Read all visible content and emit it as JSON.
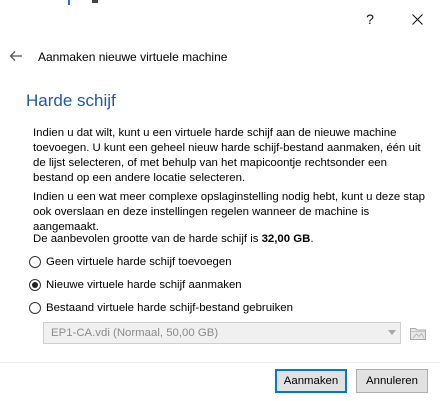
{
  "window": {
    "help_label": "?"
  },
  "header": {
    "wizard_title": "Aanmaken nieuwe virtuele machine"
  },
  "page": {
    "title": "Harde schijf",
    "paragraph1": "Indien u dat wilt, kunt u een virtuele harde schijf aan de nieuwe machine toevoegen. U kunt een geheel nieuw harde schijf-bestand aanmaken, één uit de lijst selecteren, of met behulp van het mapicoontje rechtsonder een bestand op een andere locatie selecteren.",
    "paragraph2": "Indien u een wat meer complexe opslaginstelling nodig hebt, kunt u deze stap ook overslaan en deze instellingen regelen wanneer de machine is aangemaakt.",
    "recommended_prefix": "De aanbevolen grootte van de harde schijf is ",
    "recommended_size": "32,00 GB",
    "recommended_suffix": "."
  },
  "options": {
    "no_disk": {
      "label": "Geen virtuele harde schijf toevoegen",
      "checked": false
    },
    "new_disk": {
      "label": "Nieuwe virtuele harde schijf aanmaken",
      "checked": true
    },
    "existing_disk": {
      "label": "Bestaand virtuele harde schijf-bestand gebruiken",
      "checked": false
    }
  },
  "existing_file": {
    "selected": "EP1-CA.vdi (Normaal, 50,00 GB)",
    "enabled": false
  },
  "buttons": {
    "create": "Aanmaken",
    "cancel": "Annuleren"
  },
  "icons": {
    "back": "arrow-left-icon",
    "close": "close-icon",
    "browse": "folder-icon",
    "dropdown": "chevron-down-icon"
  },
  "colors": {
    "title_blue": "#1e5aa8",
    "accent": "#0078d7",
    "disabled_text": "#8a8a8a"
  }
}
